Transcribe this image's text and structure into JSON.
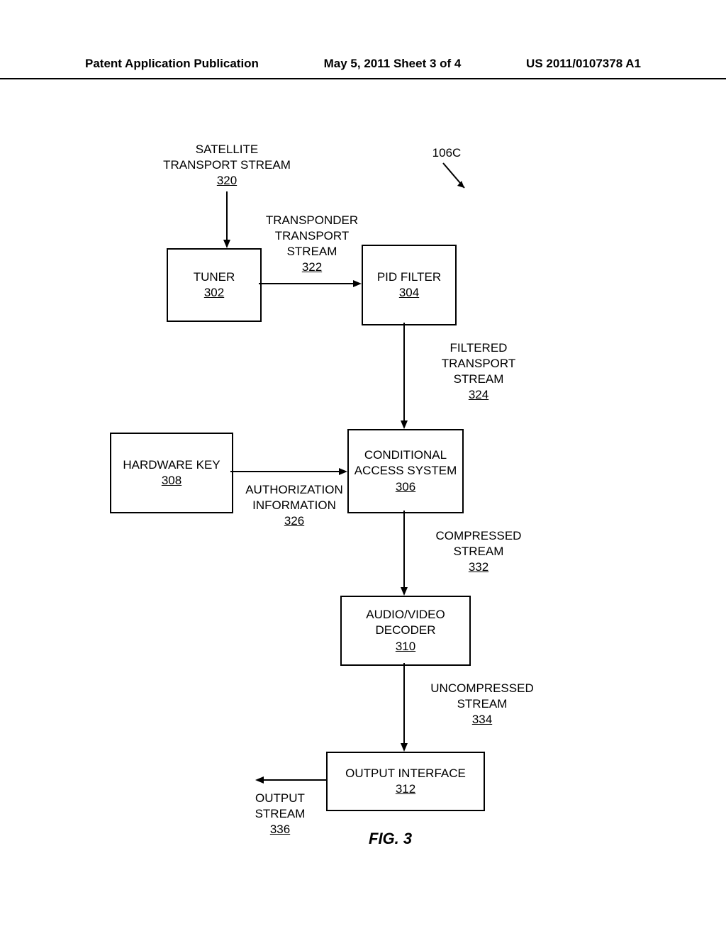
{
  "header": {
    "left": "Patent Application Publication",
    "center": "May 5, 2011  Sheet 3 of 4",
    "right": "US 2011/0107378 A1"
  },
  "labels": {
    "satellite_stream": "SATELLITE TRANSPORT STREAM",
    "satellite_stream_ref": "320",
    "ref_106c": "106C",
    "transponder_stream": "TRANSPONDER TRANSPORT STREAM",
    "transponder_stream_ref": "322",
    "filtered_stream": "FILTERED TRANSPORT STREAM",
    "filtered_stream_ref": "324",
    "auth_info": "AUTHORIZATION INFORMATION",
    "auth_info_ref": "326",
    "compressed_stream": "COMPRESSED STREAM",
    "compressed_stream_ref": "332",
    "uncompressed_stream": "UNCOMPRESSED STREAM",
    "uncompressed_stream_ref": "334",
    "output_stream": "OUTPUT STREAM",
    "output_stream_ref": "336"
  },
  "boxes": {
    "tuner": "TUNER",
    "tuner_ref": "302",
    "pid_filter": "PID FILTER",
    "pid_filter_ref": "304",
    "hardware_key": "HARDWARE KEY",
    "hardware_key_ref": "308",
    "cas": "CONDITIONAL ACCESS SYSTEM",
    "cas_ref": "306",
    "av_decoder": "AUDIO/VIDEO DECODER",
    "av_decoder_ref": "310",
    "output_if": "OUTPUT INTERFACE",
    "output_if_ref": "312"
  },
  "figure": "FIG. 3"
}
